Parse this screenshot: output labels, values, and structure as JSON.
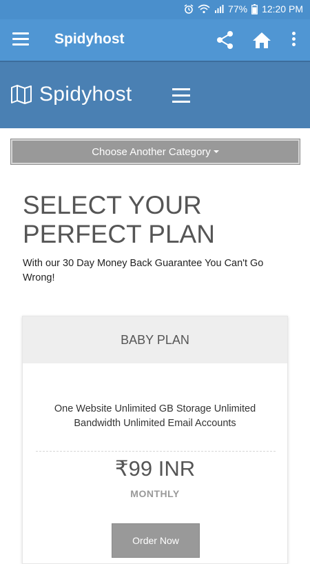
{
  "status_bar": {
    "battery": "77%",
    "time": "12:20 PM"
  },
  "app_bar": {
    "title": "Spidyhost"
  },
  "site_header": {
    "logo_text": "Spidyhost"
  },
  "category": {
    "label": "Choose Another Category"
  },
  "hero": {
    "heading": "SELECT YOUR PERFECT PLAN",
    "subtext": "With our 30 Day Money Back Guarantee You Can't Go Wrong!"
  },
  "plan": {
    "name": "BABY PLAN",
    "features": "One Website Unlimited GB Storage Unlimited Bandwidth Unlimited Email Accounts",
    "price": "₹99 INR",
    "period": "MONTHLY",
    "order_label": "Order Now"
  },
  "colors": {
    "app_bar": "#5096d3",
    "site_header": "#4a80b3",
    "button_gray": "#999999"
  },
  "icons": [
    "alarm-icon",
    "wifi-icon",
    "signal-icon",
    "battery-icon",
    "menu-icon",
    "share-icon",
    "home-icon",
    "more-vert-icon",
    "map-logo-icon",
    "site-menu-icon"
  ]
}
